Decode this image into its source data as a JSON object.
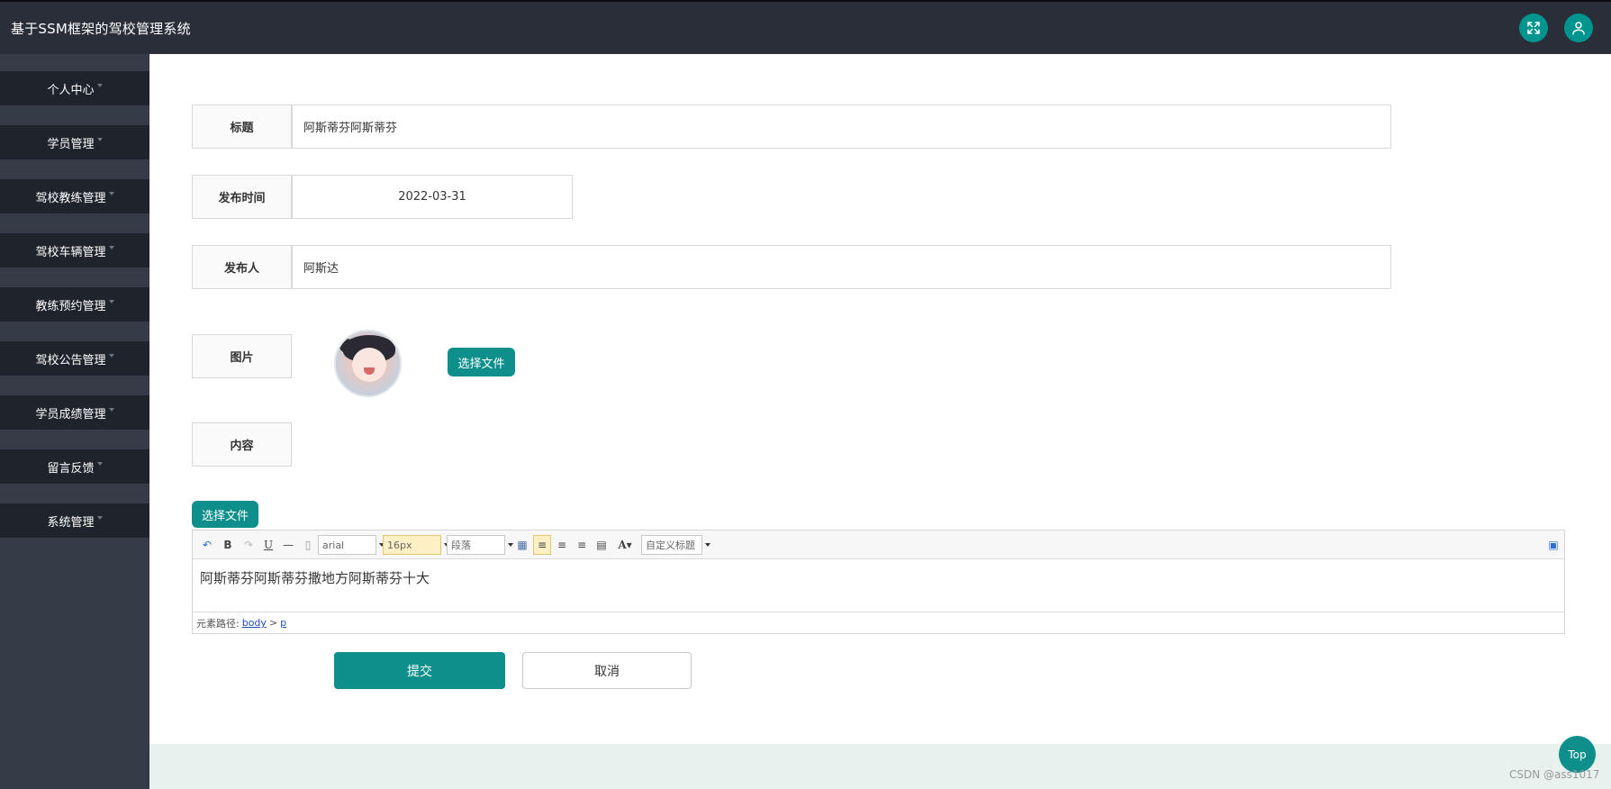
{
  "app": {
    "title": "基于SSM框架的驾校管理系统"
  },
  "sidebar": {
    "items": [
      {
        "label": "个人中心"
      },
      {
        "label": "学员管理"
      },
      {
        "label": "驾校教练管理"
      },
      {
        "label": "驾校车辆管理"
      },
      {
        "label": "教练预约管理"
      },
      {
        "label": "驾校公告管理"
      },
      {
        "label": "学员成绩管理"
      },
      {
        "label": "留言反馈"
      },
      {
        "label": "系统管理"
      }
    ]
  },
  "form": {
    "title_label": "标题",
    "title_value": "阿斯蒂芬阿斯蒂芬",
    "time_label": "发布时间",
    "time_value": "2022-03-31",
    "author_label": "发布人",
    "author_value": "阿斯达",
    "image_label": "图片",
    "image_upload_label": "选择文件",
    "content_label": "内容",
    "content_upload_label": "选择文件"
  },
  "editor": {
    "font_family": "arial",
    "font_size": "16px",
    "paragraph": "段落",
    "custom_heading": "自定义标题",
    "content": "阿斯蒂芬阿斯蒂芬撒地方阿斯蒂芬十大",
    "path_label": "元素路径:",
    "path_body": "body",
    "path_sep": ">",
    "path_p": "p"
  },
  "actions": {
    "submit": "提交",
    "cancel": "取消"
  },
  "footer": {
    "top_label": "Top",
    "watermark": "CSDN @ass1017"
  },
  "colors": {
    "topbar": "#2a2e38",
    "sidebar": "#363b48",
    "accent": "#0f8f8c"
  }
}
